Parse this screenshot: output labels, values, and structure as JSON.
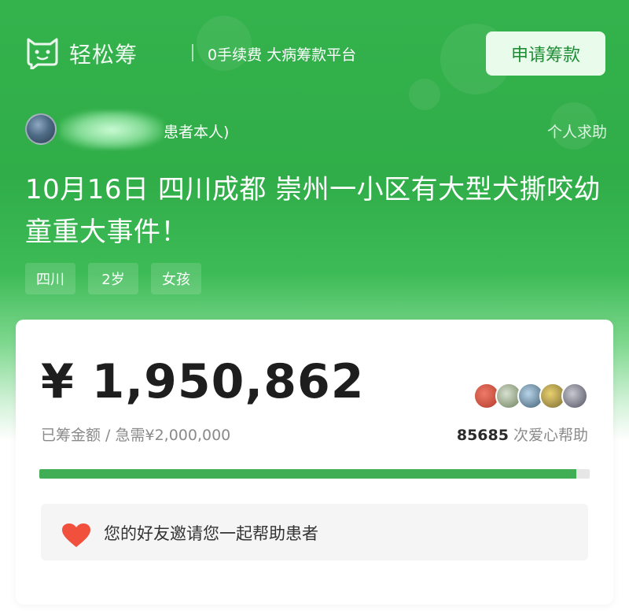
{
  "brand": {
    "name": "轻松筹",
    "slogan": "0手续费 大病筹款平台"
  },
  "header": {
    "apply_button": "申请筹款"
  },
  "user": {
    "role_text": "患者本人)",
    "help_type": "个人求助"
  },
  "campaign": {
    "title": "10月16日 四川成都 崇州一小区有大型犬撕咬幼童重大事件！",
    "tags": [
      "四川",
      "2岁",
      "女孩"
    ]
  },
  "funding": {
    "amount_raised": "¥ 1,950,862",
    "raised_label": "已筹金额 / 急需¥2,000,000",
    "helper_count": "85685",
    "helper_suffix": " 次爱心帮助",
    "progress_fraction": 0.975
  },
  "invite": {
    "text": "您的好友邀请您一起帮助患者"
  },
  "colors": {
    "brand_green": "#34b24c",
    "progress_green": "#3fae55",
    "heart": "#f0503c"
  }
}
